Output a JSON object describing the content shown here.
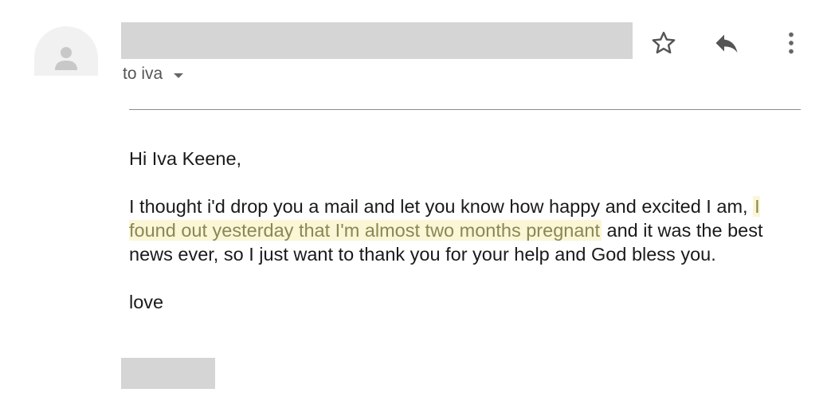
{
  "header": {
    "recipient_label": "to iva",
    "icons": {
      "avatar": "person-icon",
      "star": "star-icon",
      "reply": "reply-icon",
      "more": "more-vert-icon",
      "dropdown": "caret-down-icon"
    }
  },
  "email": {
    "greeting": "Hi Iva Keene,",
    "message_before": "I thought i'd drop you a mail and let you know how happy and excited I am,",
    "message_highlight": "I found out yesterday that I'm almost two months pregnant",
    "message_after": "and it was the best news ever, so I just want to thank you for your help and God bless you.",
    "closing": "love"
  },
  "colors": {
    "redaction": "#d5d5d5",
    "highlight_bg": "#fbf6d6",
    "highlight_text": "#8a8755"
  }
}
